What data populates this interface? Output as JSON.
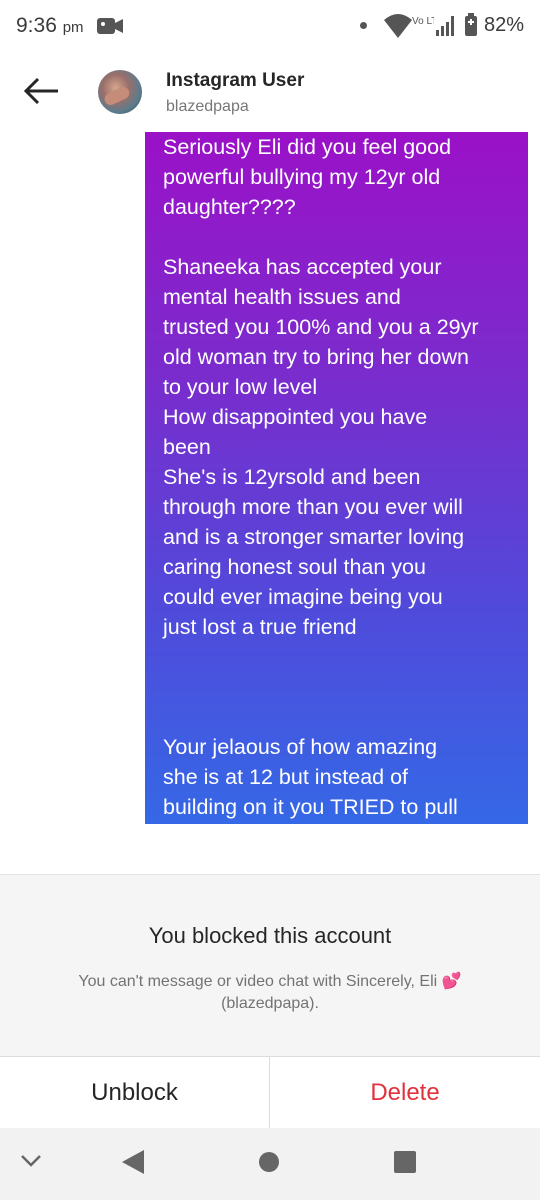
{
  "status_bar": {
    "time": "9:36",
    "ampm": "pm",
    "network": "Vo LTE",
    "battery": "82%"
  },
  "header": {
    "name": "Instagram User",
    "username": "blazedpapa"
  },
  "message": {
    "text": "Seriously Eli did you feel good\npowerful bullying my 12yr old\ndaughter????\n\nShaneeka has accepted your\nmental health issues and\ntrusted you 100% and you a 29yr\nold woman try to bring her down\nto your low level\nHow disappointed you have\nbeen\nShe's is 12yrsold and been\nthrough more than you ever will\nand is a stronger smarter loving\ncaring honest soul than you\ncould ever imagine being you\njust lost a true friend\n\n\n\nYour jelaous of how amazing\nshe is at 12 but instead of\nbuilding on it you TRIED to pull",
    "gradient_top": "#9b11c8",
    "gradient_bottom": "#3568e6"
  },
  "blocked": {
    "title": "You blocked this account",
    "subtitle": "You can't message or video chat with Sincerely, Eli",
    "emoji": "💕",
    "subtitle_username": "(blazedpapa)."
  },
  "actions": {
    "unblock_label": "Unblock",
    "delete_label": "Delete",
    "delete_color": "#e0323c"
  },
  "navbar": {
    "icons": [
      "chevron-down-icon",
      "back-triangle-icon",
      "home-circle-icon",
      "recents-square-icon"
    ]
  }
}
